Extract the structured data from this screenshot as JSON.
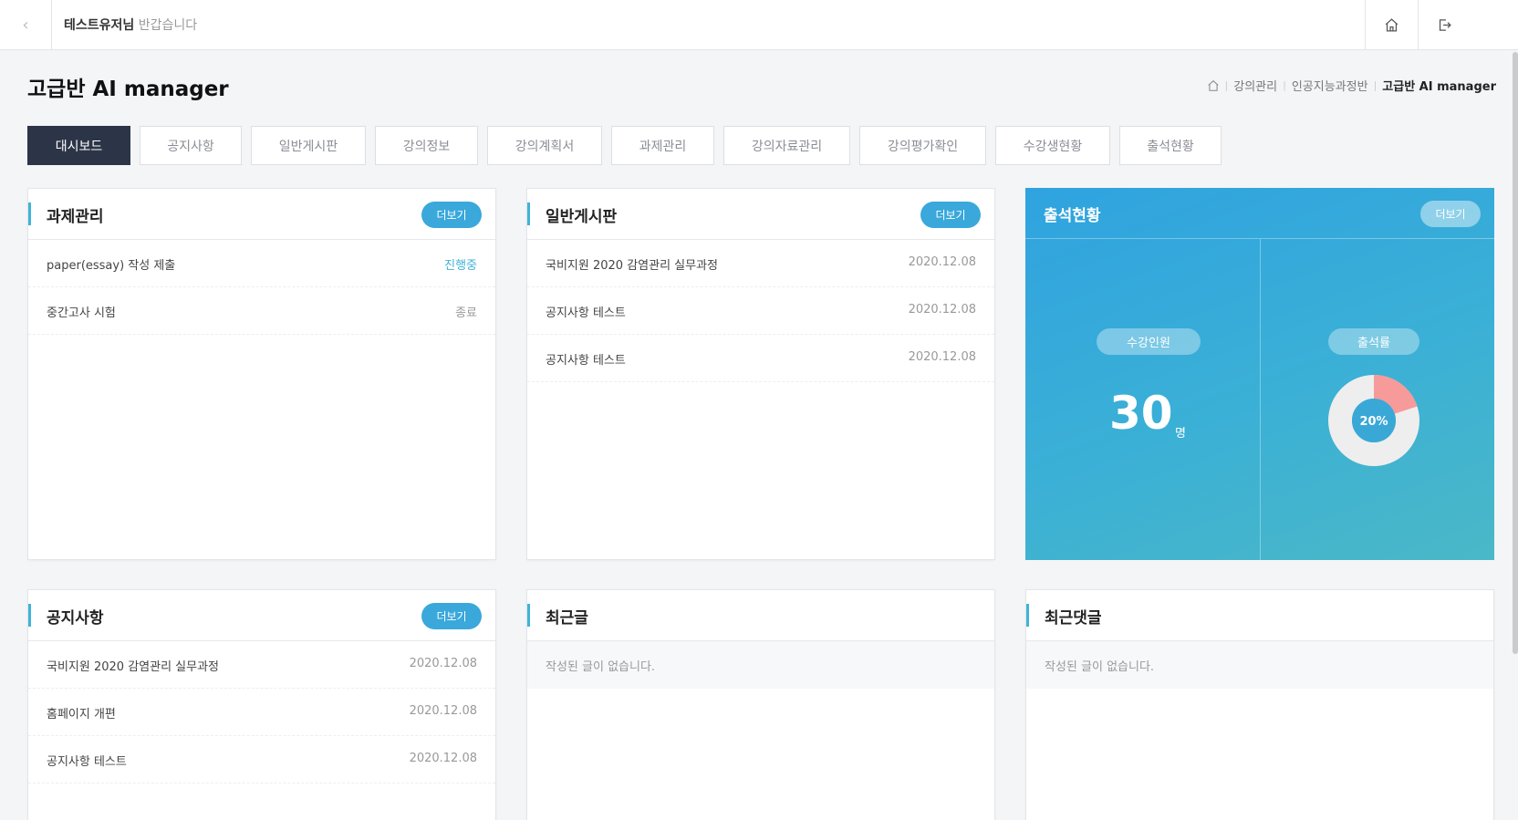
{
  "header": {
    "user_name": "테스트유저님",
    "greeting_rest": " 반갑습니다"
  },
  "page": {
    "title": "고급반 AI manager",
    "breadcrumb": [
      "강의관리",
      "인공지능과정반",
      "고급반 AI manager"
    ]
  },
  "tabs": [
    {
      "label": "대시보드",
      "active": true
    },
    {
      "label": "공지사항",
      "active": false
    },
    {
      "label": "일반게시판",
      "active": false
    },
    {
      "label": "강의정보",
      "active": false
    },
    {
      "label": "강의계획서",
      "active": false
    },
    {
      "label": "과제관리",
      "active": false
    },
    {
      "label": "강의자료관리",
      "active": false
    },
    {
      "label": "강의평가확인",
      "active": false
    },
    {
      "label": "수강생현황",
      "active": false
    },
    {
      "label": "출석현황",
      "active": false
    }
  ],
  "more_label": "더보기",
  "assignments": {
    "title": "과제관리",
    "items": [
      {
        "title": "paper(essay) 작성 제출",
        "status": "진행중"
      },
      {
        "title": "중간고사 시험",
        "status": "종료"
      }
    ]
  },
  "board": {
    "title": "일반게시판",
    "items": [
      {
        "title": "국비지원 2020 감염관리 실무과정",
        "date": "2020.12.08"
      },
      {
        "title": "공지사항 테스트",
        "date": "2020.12.08"
      },
      {
        "title": "공지사항 테스트",
        "date": "2020.12.08"
      }
    ]
  },
  "attendance": {
    "title": "출석현황",
    "enrolled_label": "수강인원",
    "enrolled_count": "30",
    "enrolled_unit": "명",
    "rate_label": "출석률",
    "rate_text": "20%",
    "rate_value": 20,
    "colors": {
      "filled": "#f79a9a",
      "empty": "#eeeeee",
      "center": "#3aa8d6"
    }
  },
  "notices": {
    "title": "공지사항",
    "items": [
      {
        "title": "국비지원 2020 감염관리 실무과정",
        "date": "2020.12.08"
      },
      {
        "title": "홈페이지 개편",
        "date": "2020.12.08"
      },
      {
        "title": "공지사항 테스트",
        "date": "2020.12.08"
      }
    ]
  },
  "recent_posts": {
    "title": "최근글",
    "empty_text": "작성된 글이 없습니다."
  },
  "recent_comments": {
    "title": "최근댓글",
    "empty_text": "작성된 글이 없습니다."
  },
  "icons": {
    "back": "chevron-left-icon",
    "home": "home-icon",
    "logout": "logout-icon"
  }
}
